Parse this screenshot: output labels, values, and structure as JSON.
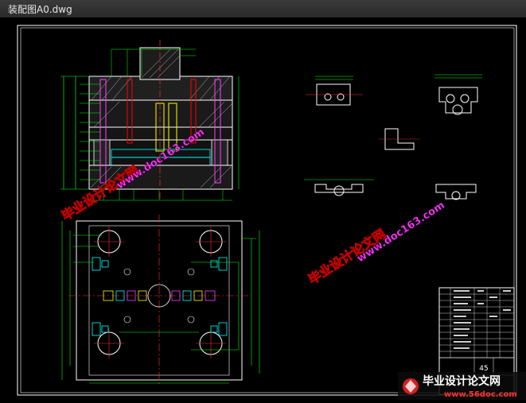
{
  "window": {
    "title": "装配图A0.dwg"
  },
  "drawing": {
    "sheet_number": "45",
    "watermark_top": "毕业设计论文网",
    "watermark_url_1": "www.doc163.com",
    "watermark_mid": "毕业设计论文网",
    "watermark_url_2": "www.doc163.com",
    "footer_brand": "毕业设计论文网",
    "footer_url": "www.56doc.com"
  }
}
